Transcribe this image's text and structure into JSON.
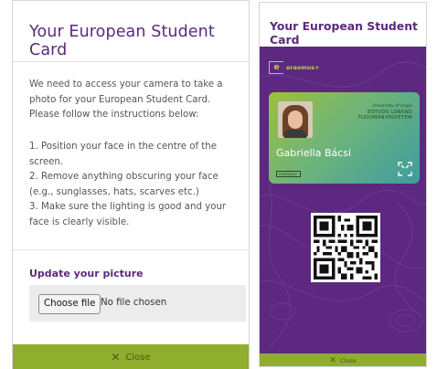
{
  "left_panel": {
    "top_label": "··· ·· · ·",
    "title": "Your European Student Card",
    "intro": "We need to access your camera to take a photo for your European Student Card. Please follow the instructions below:",
    "instructions": [
      "1. Position your face in the centre of the screen.",
      "2. Remove anything obscuring your face (e.g., sunglasses, hats, scarves etc.)",
      "3. Make sure the lighting is good and your face is clearly visible."
    ],
    "update_title": "Update your picture",
    "file_button": "Choose file",
    "file_status": "No file chosen",
    "close_label": "Close"
  },
  "right_panel": {
    "title": "Your European Student Card",
    "brand": "erasmus+",
    "card": {
      "university_line1": "University of origin",
      "university_line2": "EÖTVÖS LORÁND",
      "university_line3": "TUDOMÁNYEGYETEM",
      "holder_name": "Gabriella Bácsi",
      "mini_brand": "erasmus+"
    },
    "close_label": "Close"
  },
  "colors": {
    "brand_purple": "#5b2a7a",
    "background_purple": "#5d2880",
    "accent_green": "#8fae2e",
    "erasmus_lime": "#b9d441"
  },
  "icons": {
    "close": "x-icon",
    "qr": "qr-code-icon",
    "scan": "scan-frame-icon",
    "brand": "erasmus-logo-icon"
  }
}
